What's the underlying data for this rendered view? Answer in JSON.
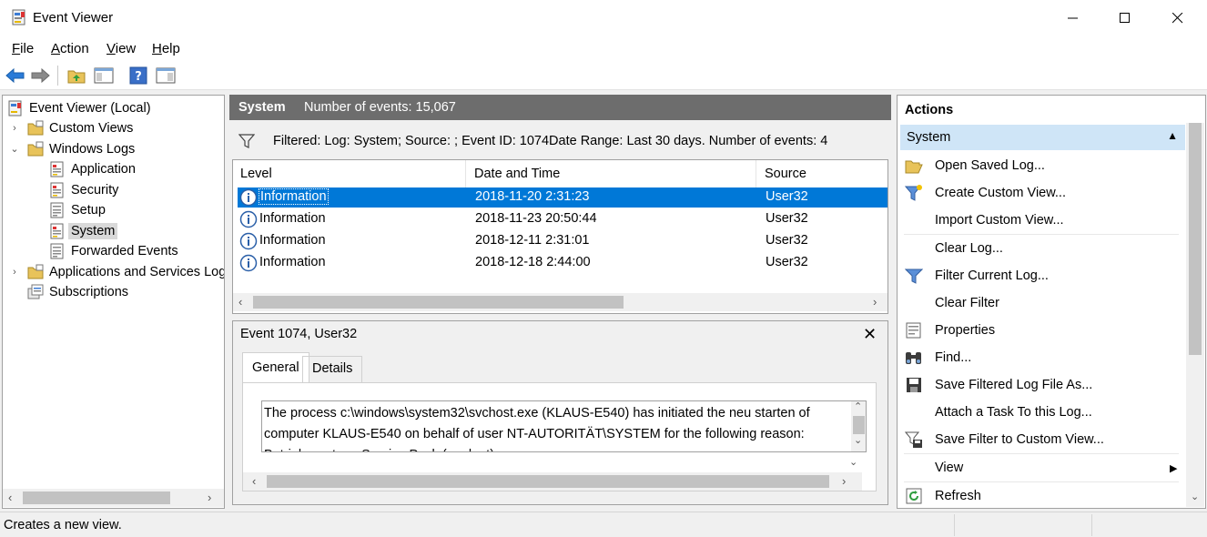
{
  "window": {
    "title": "Event Viewer"
  },
  "menu": [
    {
      "accel": "F",
      "rest": "ile"
    },
    {
      "accel": "A",
      "rest": "ction"
    },
    {
      "accel": "V",
      "rest": "iew"
    },
    {
      "accel": "H",
      "rest": "elp"
    }
  ],
  "tree": {
    "root": "Event Viewer (Local)",
    "custom_views": "Custom Views",
    "windows_logs": "Windows Logs",
    "application": "Application",
    "security": "Security",
    "setup": "Setup",
    "system": "System",
    "forwarded_events": "Forwarded Events",
    "apps_services": "Applications and Services Logs",
    "subscriptions": "Subscriptions"
  },
  "center": {
    "log_name": "System",
    "event_count": "Number of events: 15,067",
    "filter_text": "Filtered: Log: System; Source: ; Event ID: 1074Date Range: Last 30 days. Number of events: 4",
    "columns": {
      "level": "Level",
      "date": "Date and Time",
      "source": "Source"
    },
    "rows": [
      {
        "level": "Information",
        "date": "2018-11-20 2:31:23",
        "source": "User32"
      },
      {
        "level": "Information",
        "date": "2018-11-23 20:50:44",
        "source": "User32"
      },
      {
        "level": "Information",
        "date": "2018-12-11 2:31:01",
        "source": "User32"
      },
      {
        "level": "Information",
        "date": "2018-12-18 2:44:00",
        "source": "User32"
      }
    ]
  },
  "details": {
    "title": "Event 1074, User32",
    "tab_general": "General",
    "tab_details": "Details",
    "message": "The process c:\\windows\\system32\\svchost.exe (KLAUS-E540) has initiated the neu starten of computer KLAUS-E540 on behalf of user NT-AUTORITÄT\\SYSTEM for the following reason: Betriebssystem: Service Pack (geplant)"
  },
  "actions": {
    "title": "Actions",
    "section": "System",
    "items": {
      "open_saved_log": "Open Saved Log...",
      "create_custom_view": "Create Custom View...",
      "import_custom_view": "Import Custom View...",
      "clear_log": "Clear Log...",
      "filter_current_log": "Filter Current Log...",
      "clear_filter": "Clear Filter",
      "properties": "Properties",
      "find": "Find...",
      "save_filtered": "Save Filtered Log File As...",
      "attach_task": "Attach a Task To this Log...",
      "save_filter": "Save Filter to Custom View...",
      "view": "View",
      "refresh": "Refresh"
    }
  },
  "status": {
    "text": "Creates a new view."
  }
}
